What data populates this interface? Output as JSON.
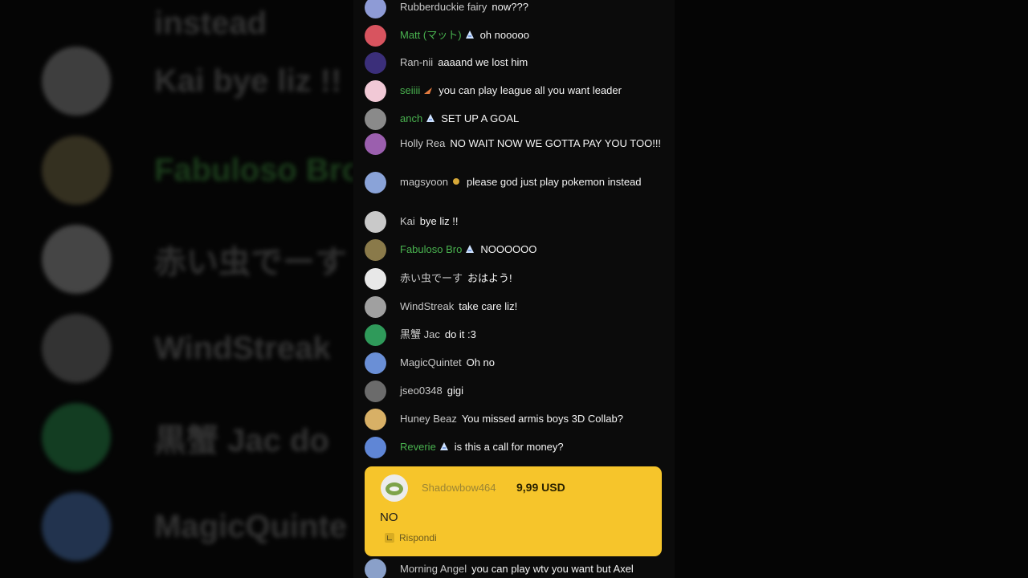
{
  "background_echo": [
    {
      "text": "instead",
      "green": false,
      "avatar_color": "#000000"
    },
    {
      "text": "Kai   bye liz !!",
      "green": false,
      "avatar_color": "#6e6e6e"
    },
    {
      "text": "Fabuloso Bro",
      "green": true,
      "avatar_color": "#5c5437"
    },
    {
      "text": "赤い虫でーす",
      "green": false,
      "avatar_color": "#7a7a7a"
    },
    {
      "text": "WindStreak",
      "green": false,
      "avatar_color": "#595959"
    },
    {
      "text": "黒蟹 Jac   do",
      "green": false,
      "avatar_color": "#1f6b3a"
    },
    {
      "text": "MagicQuinte",
      "green": false,
      "avatar_color": "#3a5a8a"
    }
  ],
  "messages": [
    {
      "author": "Rubberduckie fairy",
      "member": false,
      "text": "now???",
      "avatar_color": "#8e9bd6"
    },
    {
      "author": "Matt (マット)",
      "member": true,
      "text": "oh nooooo",
      "avatar_color": "#d8545f"
    },
    {
      "author": "Ran-nii",
      "member": false,
      "text": "aaaand we lost him",
      "avatar_color": "#3b2f7a"
    },
    {
      "author": "seiiii",
      "member": true,
      "text": "you can play league all you want leader",
      "avatar_color": "#f1c9d6"
    },
    {
      "author": "anch",
      "member": true,
      "text": "SET UP A GOAL",
      "avatar_color": "#8a8a8a"
    },
    {
      "author": "Holly Rea",
      "member": false,
      "text": "NO WAIT NOW WE GOTTA PAY YOU TOO!!!",
      "avatar_color": "#9b5fae"
    },
    {
      "author": "magsyoon",
      "member": false,
      "text": "please god just play pokemon instead",
      "avatar_color": "#8aa3d8"
    },
    {
      "author": "Kai",
      "member": false,
      "text": "bye liz !!",
      "avatar_color": "#c9c9c9"
    },
    {
      "author": "Fabuloso Bro",
      "member": true,
      "text": "NOOOOOO",
      "avatar_color": "#8a7a4a"
    },
    {
      "author": "赤い虫でーす",
      "member": false,
      "text": "おはよう!",
      "avatar_color": "#e8e8e8"
    },
    {
      "author": "WindStreak",
      "member": false,
      "text": "take care liz!",
      "avatar_color": "#a0a0a0"
    },
    {
      "author": "黒蟹 Jac",
      "member": false,
      "text": "do it :3",
      "avatar_color": "#2f9a5a"
    },
    {
      "author": "MagicQuintet",
      "member": false,
      "text": "Oh no",
      "avatar_color": "#6a8fd6"
    },
    {
      "author": "jseo0348",
      "member": false,
      "text": "gigi",
      "avatar_color": "#6b6b6b"
    },
    {
      "author": "Huney Beaz",
      "member": false,
      "text": "You missed armis boys 3D Collab?",
      "avatar_color": "#d8b066"
    },
    {
      "author": "Reverie",
      "member": true,
      "text": "is this a call for money?",
      "avatar_color": "#5f86d6"
    }
  ],
  "superchat": {
    "author": "Shadowbow464",
    "amount": "9,99 USD",
    "message": "NO",
    "reply_label": "Rispondi",
    "background": "#f6c52b"
  },
  "last_message": {
    "author": "Morning Angel",
    "member": false,
    "text": "you can play wtv you want but Axel",
    "avatar_color": "#8aa0c9"
  },
  "colors": {
    "member_name": "#49b24f",
    "name": "#c8c8c8",
    "panel": "#0b0b0b"
  },
  "icons": {
    "member_badge": "member-badge-icon",
    "reply": "reply-icon"
  }
}
